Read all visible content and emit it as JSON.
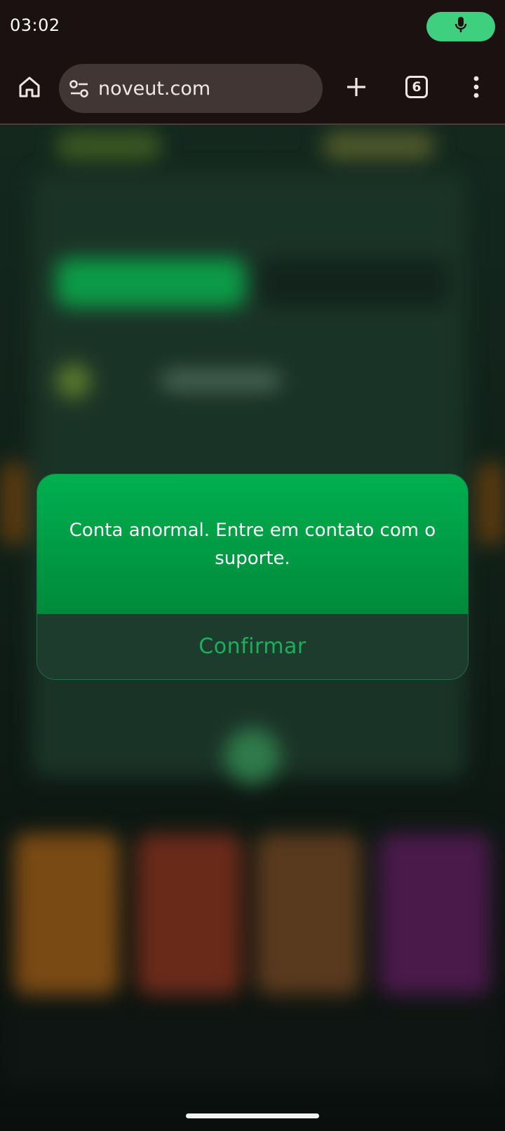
{
  "status_bar": {
    "time": "03:02",
    "mic_icon": "microphone-icon",
    "mic_color": "#3ecf7f"
  },
  "browser": {
    "url": "noveut.com",
    "tab_count": "6",
    "icons": [
      "home-icon",
      "site-settings-icon",
      "plus-icon",
      "tab-switcher-icon",
      "more-vert-icon"
    ]
  },
  "dialog": {
    "message": "Conta anormal. Entre em contato com o suporte.",
    "confirm_label": "Confirmar",
    "accent": "#00b04f",
    "button_text_color": "#17b25a"
  }
}
